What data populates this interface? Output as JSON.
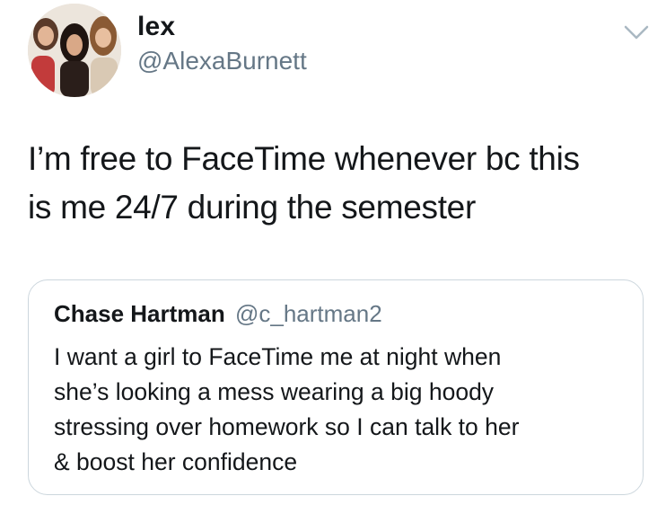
{
  "author": {
    "display_name": "lex",
    "handle": "@AlexaBurnett",
    "avatar_icon": "profile-photo"
  },
  "menu": {
    "icon": "chevron-down-icon"
  },
  "tweet": {
    "lines": [
      "I’m free to FaceTime whenever bc this",
      "is me 24/7 during the semester"
    ]
  },
  "quoted_tweet": {
    "display_name": "Chase Hartman",
    "handle": "@c_hartman2",
    "lines": [
      "I want a girl to FaceTime me at night when",
      "she’s looking a mess wearing a big hoody",
      "stressing over homework so I can talk to her",
      "& boost her confidence"
    ]
  },
  "colors": {
    "text_primary": "#14171a",
    "text_secondary": "#657786",
    "border": "#ccd6dd"
  }
}
